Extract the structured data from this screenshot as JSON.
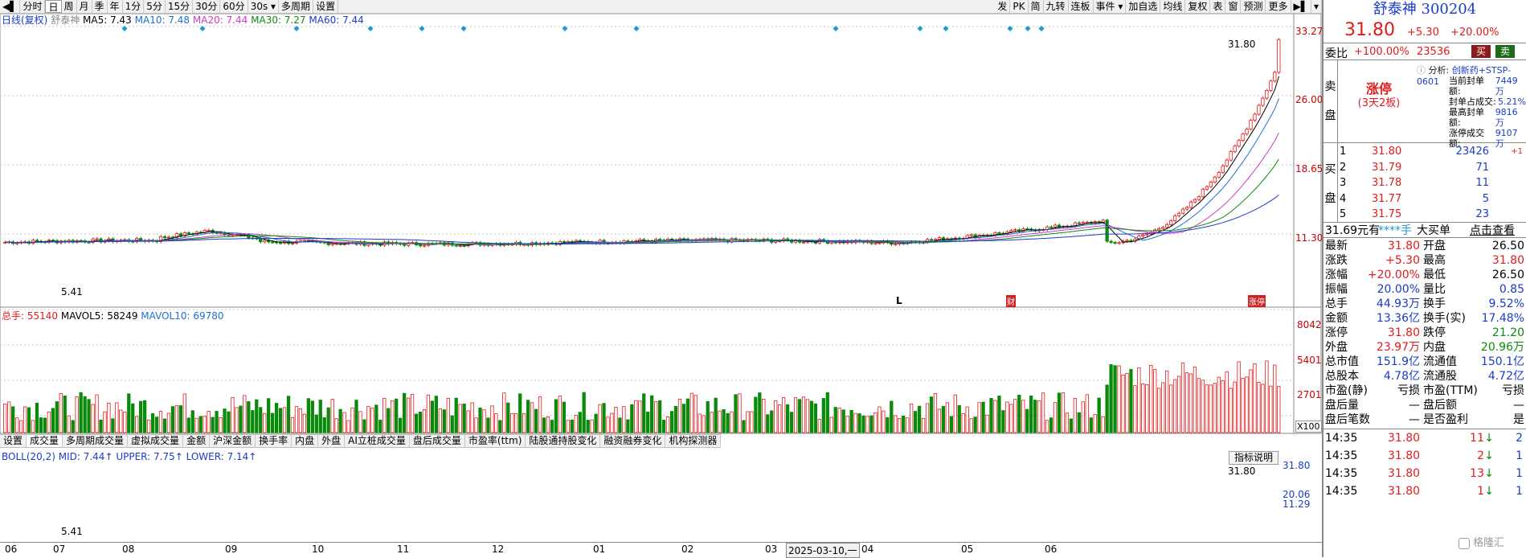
{
  "toolbar": {
    "left": [
      "◀▌",
      "分时",
      "日",
      "周",
      "月",
      "季",
      "年",
      "1分",
      "5分",
      "15分",
      "30分",
      "60分",
      "30s ▾",
      "多周期",
      "设置"
    ],
    "active_index": 2,
    "right": [
      "发",
      "PK",
      "简",
      "九转",
      "连板",
      "事件 ▾",
      "加自选",
      "均线",
      "复权",
      "表",
      "窗",
      "预测",
      "更多",
      "▶▌",
      "▾"
    ]
  },
  "main_legend": {
    "prefix": "日线(复权)",
    "name": "舒泰神",
    "ma5": "MA5: 7.43",
    "ma10": "MA10: 7.48",
    "ma20": "MA20: 7.44",
    "ma30": "MA30: 7.27",
    "ma60": "MA60: 7.44"
  },
  "price_axis": [
    "33.27",
    "26.00",
    "18.65",
    "11.30"
  ],
  "price_annot": {
    "high": "31.80",
    "low": "5.41",
    "L_mark": "L",
    "bottom_tag": "财",
    "end_tag": "涨停"
  },
  "volume_legend": {
    "total": "总手: 55140",
    "mavol5": "MAVOL5: 58249",
    "mavol10": "MAVOL10: 69780"
  },
  "volume_axis": [
    "8042",
    "5401",
    "2701",
    "X100"
  ],
  "indicator_tabs": [
    "设置",
    "成交量",
    "多周期成交量",
    "虚拟成交量",
    "金额",
    "沪深金额",
    "换手率",
    "内盘",
    "外盘",
    "AI立桩成交量",
    "盘后成交量",
    "市盈率(ttm)",
    "陆股通持股变化",
    "融资融券变化",
    "机构探测器"
  ],
  "indicator_active": 1,
  "boll_legend": {
    "mid": "BOLL(20,2) MID: 7.44↑",
    "upper": "UPPER: 7.75↑",
    "lower": "LOWER: 7.14↑"
  },
  "boll_axis": [
    "31.80",
    "20.06",
    "11.29"
  ],
  "boll_annot": {
    "high": "31.80",
    "low": "5.41",
    "help_btn": "指标说明"
  },
  "date_axis": [
    "06",
    "07",
    "08",
    "09",
    "10",
    "11",
    "12",
    "01",
    "02",
    "03",
    "2025-03-10,一",
    "04",
    "05",
    "06"
  ],
  "panel": {
    "title": "舒泰神 300204",
    "price": "31.80",
    "change": "+5.30",
    "change_pct": "+20.00%",
    "weibi_label": "委比",
    "weibi": "+100.00%",
    "weicha": "23536",
    "buy_btn": "买",
    "sell_btn": "卖",
    "sell_side_label": [
      "卖",
      "盘"
    ],
    "limit_status": "涨停",
    "limit_days": "(3天2板)",
    "analysis_title": "分析:",
    "analysis_tag": "创新药+STSP-0601",
    "analysis": [
      {
        "k": "当前封单额:",
        "v": "7449万"
      },
      {
        "k": "封单占成交:",
        "v": "5.21%"
      },
      {
        "k": "最高封单额:",
        "v": "9816万"
      },
      {
        "k": "涨停成交额:",
        "v": "9107万"
      }
    ],
    "buy_side_label": [
      "买",
      "盘"
    ],
    "bids": [
      {
        "n": "1",
        "p": "31.80",
        "v": "23426",
        "d": "+1"
      },
      {
        "n": "2",
        "p": "31.79",
        "v": "71",
        "d": ""
      },
      {
        "n": "3",
        "p": "31.78",
        "v": "11",
        "d": ""
      },
      {
        "n": "4",
        "p": "31.77",
        "v": "5",
        "d": ""
      },
      {
        "n": "5",
        "p": "31.75",
        "v": "23",
        "d": ""
      }
    ],
    "big_order": {
      "a": "31.69元有",
      "b": "****手",
      "c": "大买单",
      "d": "点击查看"
    },
    "stats": [
      {
        "k1": "最新",
        "v1": "31.80",
        "c1": "red",
        "k2": "开盘",
        "v2": "26.50",
        "c2": "black"
      },
      {
        "k1": "涨跌",
        "v1": "+5.30",
        "c1": "red",
        "k2": "最高",
        "v2": "31.80",
        "c2": "red"
      },
      {
        "k1": "涨幅",
        "v1": "+20.00%",
        "c1": "red",
        "k2": "最低",
        "v2": "26.50",
        "c2": "black"
      },
      {
        "k1": "振幅",
        "v1": "20.00%",
        "c1": "blue",
        "k2": "量比",
        "v2": "0.85",
        "c2": "blue"
      },
      {
        "k1": "总手",
        "v1": "44.93万",
        "c1": "blue",
        "k2": "换手",
        "v2": "9.52%",
        "c2": "blue"
      },
      {
        "k1": "金额",
        "v1": "13.36亿",
        "c1": "blue",
        "k2": "换手(实)",
        "v2": "17.48%",
        "c2": "blue"
      },
      {
        "k1": "涨停",
        "v1": "31.80",
        "c1": "red",
        "k2": "跌停",
        "v2": "21.20",
        "c2": "green"
      },
      {
        "k1": "外盘",
        "v1": "23.97万",
        "c1": "red",
        "k2": "内盘",
        "v2": "20.96万",
        "c2": "green"
      },
      {
        "k1": "总市值",
        "v1": "151.9亿",
        "c1": "blue",
        "k2": "流通值",
        "v2": "150.1亿",
        "c2": "blue"
      },
      {
        "k1": "总股本",
        "v1": "4.78亿",
        "c1": "blue",
        "k2": "流通股",
        "v2": "4.72亿",
        "c2": "blue"
      },
      {
        "k1": "市盈(静)",
        "v1": "亏损",
        "c1": "black",
        "k2": "市盈(TTM)",
        "v2": "亏损",
        "c2": "black"
      },
      {
        "k1": "盘后量",
        "v1": "—",
        "c1": "black",
        "k2": "盘后额",
        "v2": "—",
        "c2": "black"
      },
      {
        "k1": "盘后笔数",
        "v1": "—",
        "c1": "black",
        "k2": "是否盈利",
        "v2": "是",
        "c2": "black"
      }
    ],
    "ticks": [
      {
        "t": "14:35",
        "p": "31.80",
        "v": "11",
        "a": "↓",
        "n": "2"
      },
      {
        "t": "14:35",
        "p": "31.80",
        "v": "2",
        "a": "↓",
        "n": "1"
      },
      {
        "t": "14:35",
        "p": "31.80",
        "v": "13",
        "a": "↓",
        "n": "1"
      },
      {
        "t": "14:35",
        "p": "31.80",
        "v": "1",
        "a": "↓",
        "n": "1"
      }
    ],
    "watermark": "格隆汇"
  },
  "colors": {
    "up": "#e01b1b",
    "down": "#0a8a0a",
    "ma5": "#000000",
    "ma10": "#1e6fd0",
    "ma20": "#d038c8",
    "ma30": "#118a11",
    "ma60": "#1a3cc8",
    "grid": "#c8c8c8"
  }
}
